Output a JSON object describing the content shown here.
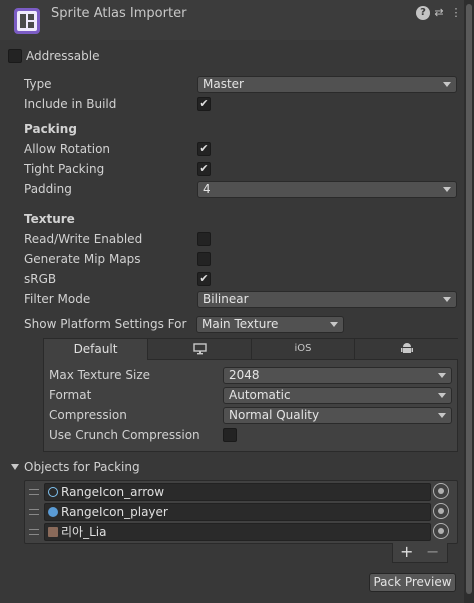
{
  "header": {
    "title": "Sprite Atlas Importer",
    "icons": [
      "sprite-atlas-icon",
      "help-icon",
      "settings-icon",
      "kebab-menu-icon"
    ]
  },
  "addressable": {
    "label": "Addressable",
    "checked": false
  },
  "fields": {
    "type": {
      "label": "Type",
      "value": "Master"
    },
    "include_in_build": {
      "label": "Include in Build",
      "checked": true
    }
  },
  "packing": {
    "title": "Packing",
    "allow_rotation": {
      "label": "Allow Rotation",
      "checked": true
    },
    "tight_packing": {
      "label": "Tight Packing",
      "checked": true
    },
    "padding": {
      "label": "Padding",
      "value": "4"
    }
  },
  "texture": {
    "title": "Texture",
    "read_write": {
      "label": "Read/Write Enabled",
      "checked": false
    },
    "mip_maps": {
      "label": "Generate Mip Maps",
      "checked": false
    },
    "srgb": {
      "label": "sRGB",
      "checked": true
    },
    "filter_mode": {
      "label": "Filter Mode",
      "value": "Bilinear"
    }
  },
  "platform": {
    "label": "Show Platform Settings For",
    "value": "Main Texture",
    "tabs": [
      {
        "label": "Default",
        "icon": ""
      },
      {
        "label": "",
        "icon": "monitor-icon"
      },
      {
        "label": "iOS",
        "icon": ""
      },
      {
        "label": "",
        "icon": "android-icon"
      }
    ],
    "max_texture_size": {
      "label": "Max Texture Size",
      "value": "2048"
    },
    "format": {
      "label": "Format",
      "value": "Automatic"
    },
    "compression": {
      "label": "Compression",
      "value": "Normal Quality"
    },
    "crunch": {
      "label": "Use Crunch Compression",
      "checked": false
    }
  },
  "objects": {
    "title": "Objects for Packing",
    "items": [
      {
        "name": "RangeIcon_arrow",
        "icon": "sprite-icon"
      },
      {
        "name": "RangeIcon_player",
        "icon": "sprite-icon"
      },
      {
        "name": "리아_Lia",
        "icon": "texture-icon"
      }
    ],
    "add_label": "+",
    "remove_label": "−"
  },
  "pack_preview_label": "Pack Preview",
  "colors": {
    "background": "#383838",
    "field": "#515151",
    "text": "#d2d2d2"
  }
}
